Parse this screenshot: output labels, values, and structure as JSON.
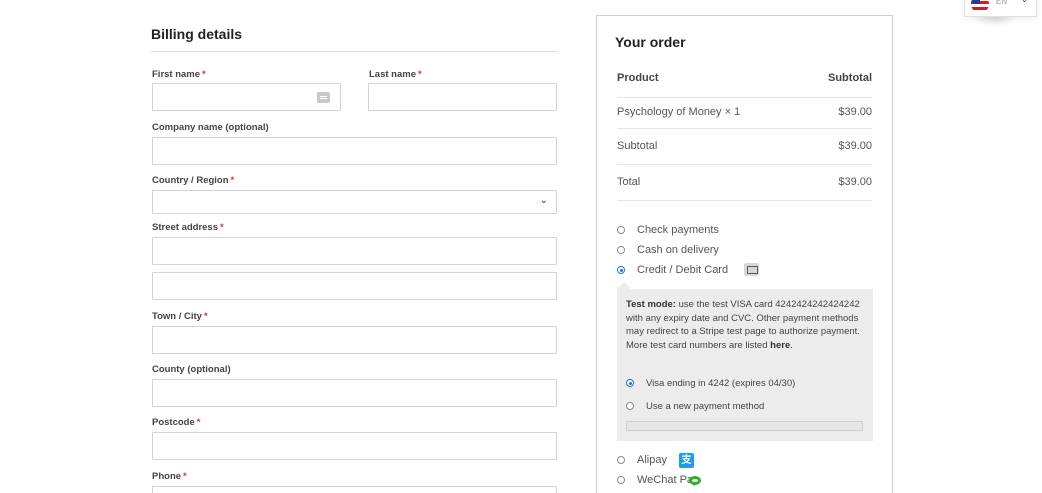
{
  "billing": {
    "title": "Billing details",
    "required_mark": "*",
    "fields": {
      "first_name": "First name",
      "last_name": "Last name",
      "company": "Company name (optional)",
      "country": "Country / Region",
      "street": "Street address",
      "town": "Town / City",
      "county": "County (optional)",
      "postcode": "Postcode",
      "phone": "Phone"
    }
  },
  "order": {
    "title": "Your order",
    "headers": {
      "product": "Product",
      "subtotal": "Subtotal"
    },
    "items": [
      {
        "name": "Psychology of Money × 1",
        "price": "$39.00"
      }
    ],
    "subtotal": {
      "label": "Subtotal",
      "value": "$39.00"
    },
    "total": {
      "label": "Total",
      "value": "$39.00"
    }
  },
  "payment": {
    "methods": [
      {
        "label": "Check payments",
        "selected": false
      },
      {
        "label": "Cash on delivery",
        "selected": false
      },
      {
        "label": "Credit / Debit Card",
        "selected": true,
        "icon": "credit-card-icon"
      },
      {
        "label": "Alipay",
        "selected": false,
        "icon": "alipay-icon"
      },
      {
        "label": "WeChat Pay",
        "selected": false,
        "icon": "wechat-icon"
      }
    ],
    "stripe": {
      "test_mode_label": "Test mode:",
      "test_mode_text": " use the test VISA card 4242424242424242 with any expiry date and CVC. Other payment methods may redirect to a Stripe test page to authorize payment. More test card numbers are listed ",
      "here_link": "here",
      "period": ".",
      "saved_card": "Visa ending in 4242 (expires 04/30)",
      "new_method": "Use a new payment method"
    }
  },
  "lang": {
    "code": "EN",
    "flag": "us-flag-icon"
  },
  "colors": {
    "required": "#d63638",
    "radio_active": "#2a6fd6",
    "alipay": "#1c9fe6",
    "wechat": "#2bb22b"
  }
}
